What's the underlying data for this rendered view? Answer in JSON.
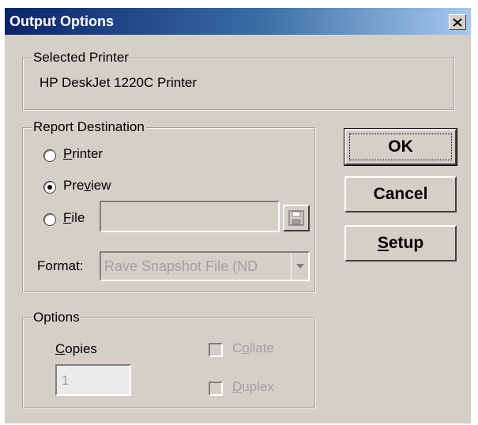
{
  "window": {
    "title": "Output Options"
  },
  "selected_printer": {
    "group_label": "Selected Printer",
    "printer_name": "HP DeskJet 1220C Printer"
  },
  "report_destination": {
    "group_label": "Report Destination",
    "options": {
      "printer": {
        "pre": "",
        "underline": "P",
        "post": "rinter",
        "selected": false
      },
      "preview": {
        "pre": "Pre",
        "underline": "v",
        "post": "iew",
        "selected": true
      },
      "file": {
        "pre": "",
        "underline": "F",
        "post": "ile",
        "selected": false
      }
    },
    "file_path_value": "",
    "format_label": "Format:",
    "format_value": "Rave Snapshot File (ND"
  },
  "options": {
    "group_label": "Options",
    "copies": {
      "pre": "",
      "underline": "C",
      "post": "opies",
      "value": "1"
    },
    "collate": {
      "pre": "C",
      "underline": "o",
      "post": "llate",
      "checked": false,
      "enabled": false
    },
    "duplex": {
      "pre": "",
      "underline": "D",
      "post": "uplex",
      "checked": false,
      "enabled": false
    }
  },
  "buttons": {
    "ok": "OK",
    "cancel": "Cancel",
    "setup": {
      "pre": "",
      "underline": "S",
      "post": "etup"
    }
  },
  "icons": {
    "close": "close-icon",
    "save": "floppy-disk-icon",
    "dropdown": "chevron-down-icon"
  },
  "colors": {
    "dialog_face": "#d4d0c8",
    "title_start": "#0a246a",
    "title_end": "#a6caf0",
    "disabled_text": "#a0a0a0"
  }
}
